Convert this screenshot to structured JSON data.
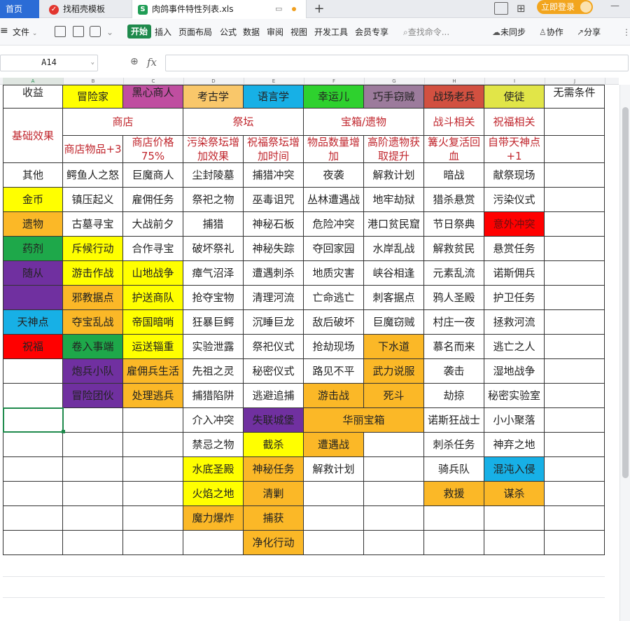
{
  "tabs": [
    {
      "label": "首页",
      "active": false
    },
    {
      "label": "找稻壳模板",
      "active": false
    },
    {
      "label": "肉鸽事件特性列表.xls",
      "active": true
    }
  ],
  "login_label": "立即登录",
  "menu": {
    "file": "文件",
    "items": [
      "开始",
      "插入",
      "页面布局",
      "公式",
      "数据",
      "审阅",
      "视图",
      "开发工具",
      "会员专享"
    ],
    "search_placeholder": "查找命令...",
    "sync": "未同步",
    "collab": "协作",
    "share": "分享"
  },
  "formula_bar": {
    "cell_ref": "A14",
    "fx": "fx",
    "value": ""
  },
  "columns": [
    "A",
    "B",
    "C",
    "D",
    "E",
    "F",
    "G",
    "H",
    "I",
    "J"
  ],
  "colors": {
    "yellow": "#ffff00",
    "pink": "#bf4ea0",
    "tan": "#f9c76a",
    "cyan": "#17b0e6",
    "green": "#2ed12e",
    "mauve": "#9c7b9c",
    "brickred": "#d25040",
    "olive": "#e1e548",
    "orange": "#fbb827",
    "darkgreen": "#1ea84a",
    "purple": "#7030a0",
    "red": "#ff0000",
    "accent": "#1f8a4c"
  },
  "cells": [
    {
      "id": "A1",
      "t": "收益"
    },
    {
      "id": "B1",
      "t": "冒险家"
    },
    {
      "id": "C1",
      "t": "黑心商人"
    },
    {
      "id": "D1",
      "t": "考古学"
    },
    {
      "id": "E1",
      "t": "语言学"
    },
    {
      "id": "F1",
      "t": "幸运儿"
    },
    {
      "id": "G1",
      "t": "巧手窃贼"
    },
    {
      "id": "H1",
      "t": "战场老兵"
    },
    {
      "id": "I1",
      "t": "使徒"
    },
    {
      "id": "J1",
      "t": "无需条件"
    },
    {
      "id": "A2",
      "t": "基础效果"
    },
    {
      "id": "B2",
      "t": "商店"
    },
    {
      "id": "D2",
      "t": "祭坛"
    },
    {
      "id": "F2",
      "t": "宝箱/遗物"
    },
    {
      "id": "H2",
      "t": "战斗相关"
    },
    {
      "id": "I2",
      "t": "祝福相关"
    },
    {
      "id": "B3",
      "t": "商店物品+3"
    },
    {
      "id": "C3",
      "t": "商店价格75%"
    },
    {
      "id": "D3",
      "t": "污染祭坛增加效果"
    },
    {
      "id": "E3",
      "t": "祝福祭坛增加时间"
    },
    {
      "id": "F3",
      "t": "物品数量增加"
    },
    {
      "id": "G3",
      "t": "高阶遗物获取提升"
    },
    {
      "id": "H3",
      "t": "篝火复活回血"
    },
    {
      "id": "I3",
      "t": "自带天神点+1"
    },
    {
      "id": "A4",
      "t": "其他"
    },
    {
      "id": "B4",
      "t": "鳄鱼人之怒"
    },
    {
      "id": "C4",
      "t": "巨魔商人"
    },
    {
      "id": "D4",
      "t": "尘封陵墓"
    },
    {
      "id": "E4",
      "t": "捕猎冲突"
    },
    {
      "id": "F4",
      "t": "夜袭"
    },
    {
      "id": "G4",
      "t": "解救计划"
    },
    {
      "id": "H4",
      "t": "暗战"
    },
    {
      "id": "I4",
      "t": "献祭现场"
    },
    {
      "id": "A5",
      "t": "金币"
    },
    {
      "id": "B5",
      "t": "镇压起义"
    },
    {
      "id": "C5",
      "t": "雇佣任务"
    },
    {
      "id": "D5",
      "t": "祭祀之物"
    },
    {
      "id": "E5",
      "t": "巫毒诅咒"
    },
    {
      "id": "F5",
      "t": "丛林遭遇战"
    },
    {
      "id": "G5",
      "t": "地牢劫狱"
    },
    {
      "id": "H5",
      "t": "猎杀悬赏"
    },
    {
      "id": "I5",
      "t": "污染仪式"
    },
    {
      "id": "A6",
      "t": "遗物"
    },
    {
      "id": "B6",
      "t": "古墓寻宝"
    },
    {
      "id": "C6",
      "t": "大战前夕"
    },
    {
      "id": "D6",
      "t": "捕猎"
    },
    {
      "id": "E6",
      "t": "神秘石板"
    },
    {
      "id": "F6",
      "t": "危险冲突"
    },
    {
      "id": "G6",
      "t": "港口贫民窟"
    },
    {
      "id": "H6",
      "t": "节日祭典"
    },
    {
      "id": "I6",
      "t": "意外冲突"
    },
    {
      "id": "A7",
      "t": "药剂"
    },
    {
      "id": "B7",
      "t": "斥候行动"
    },
    {
      "id": "C7",
      "t": "合作寻宝"
    },
    {
      "id": "D7",
      "t": "破坏祭礼"
    },
    {
      "id": "E7",
      "t": "神秘失踪"
    },
    {
      "id": "F7",
      "t": "夺回家园"
    },
    {
      "id": "G7",
      "t": "水岸乱战"
    },
    {
      "id": "H7",
      "t": "解救贫民"
    },
    {
      "id": "I7",
      "t": "悬赏任务"
    },
    {
      "id": "A8",
      "t": "随从"
    },
    {
      "id": "B8",
      "t": "游击作战"
    },
    {
      "id": "C8",
      "t": "山地战争"
    },
    {
      "id": "D8",
      "t": "瘴气沼泽"
    },
    {
      "id": "E8",
      "t": "遭遇刺杀"
    },
    {
      "id": "F8",
      "t": "地质灾害"
    },
    {
      "id": "G8",
      "t": "峡谷相逢"
    },
    {
      "id": "H8",
      "t": "元素乱流"
    },
    {
      "id": "I8",
      "t": "诺斯佣兵"
    },
    {
      "id": "B9",
      "t": "邪教据点"
    },
    {
      "id": "C9",
      "t": "护送商队"
    },
    {
      "id": "D9",
      "t": "抢夺宝物"
    },
    {
      "id": "E9",
      "t": "清理河流"
    },
    {
      "id": "F9",
      "t": "亡命逃亡"
    },
    {
      "id": "G9",
      "t": "刺客据点"
    },
    {
      "id": "H9",
      "t": "鸦人圣殿"
    },
    {
      "id": "I9",
      "t": "护卫任务"
    },
    {
      "id": "A10",
      "t": "天神点"
    },
    {
      "id": "B10",
      "t": "夺宝乱战"
    },
    {
      "id": "C10",
      "t": "帝国暗哨"
    },
    {
      "id": "D10",
      "t": "狂暴巨鳄"
    },
    {
      "id": "E10",
      "t": "沉睡巨龙"
    },
    {
      "id": "F10",
      "t": "敌后破坏"
    },
    {
      "id": "G10",
      "t": "巨魔窃贼"
    },
    {
      "id": "H10",
      "t": "村庄一夜"
    },
    {
      "id": "I10",
      "t": "拯救河流"
    },
    {
      "id": "A11",
      "t": "祝福"
    },
    {
      "id": "B11",
      "t": "卷入事端"
    },
    {
      "id": "C11",
      "t": "运送辎重"
    },
    {
      "id": "D11",
      "t": "实验泄露"
    },
    {
      "id": "E11",
      "t": "祭祀仪式"
    },
    {
      "id": "F11",
      "t": "抢劫现场"
    },
    {
      "id": "G11",
      "t": "下水道"
    },
    {
      "id": "H11",
      "t": "慕名而来"
    },
    {
      "id": "I11",
      "t": "逃亡之人"
    },
    {
      "id": "B12",
      "t": "炮兵小队"
    },
    {
      "id": "C12",
      "t": "雇佣兵生活"
    },
    {
      "id": "D12",
      "t": "先祖之灵"
    },
    {
      "id": "E12",
      "t": "秘密仪式"
    },
    {
      "id": "F12",
      "t": "路见不平"
    },
    {
      "id": "G12",
      "t": "武力说服"
    },
    {
      "id": "H12",
      "t": "袭击"
    },
    {
      "id": "I12",
      "t": "湿地战争"
    },
    {
      "id": "B13",
      "t": "冒险团伙"
    },
    {
      "id": "C13",
      "t": "处理逃兵"
    },
    {
      "id": "D13",
      "t": "捕猎陷阱"
    },
    {
      "id": "E13",
      "t": "逃避追捕"
    },
    {
      "id": "F13",
      "t": "游击战"
    },
    {
      "id": "G13",
      "t": "死斗"
    },
    {
      "id": "H13",
      "t": "劫掠"
    },
    {
      "id": "I13",
      "t": "秘密实验室"
    },
    {
      "id": "D14",
      "t": "介入冲突"
    },
    {
      "id": "E14",
      "t": "失联城堡"
    },
    {
      "id": "F14",
      "t": "华丽宝箱"
    },
    {
      "id": "H14",
      "t": "诺斯狂战士"
    },
    {
      "id": "I14",
      "t": "小小聚落"
    },
    {
      "id": "D15",
      "t": "禁忌之物"
    },
    {
      "id": "E15",
      "t": "截杀"
    },
    {
      "id": "F15",
      "t": "遭遇战"
    },
    {
      "id": "H15",
      "t": "刺杀任务"
    },
    {
      "id": "I15",
      "t": "神弃之地"
    },
    {
      "id": "D16",
      "t": "水底圣殿"
    },
    {
      "id": "E16",
      "t": "神秘任务"
    },
    {
      "id": "F16",
      "t": "解救计划"
    },
    {
      "id": "H16",
      "t": "骑兵队"
    },
    {
      "id": "I16",
      "t": "混沌入侵"
    },
    {
      "id": "D17",
      "t": "火焰之地"
    },
    {
      "id": "E17",
      "t": "清剿"
    },
    {
      "id": "H17",
      "t": "救援"
    },
    {
      "id": "I17",
      "t": "谋杀"
    },
    {
      "id": "D18",
      "t": "魔力爆炸"
    },
    {
      "id": "E18",
      "t": "捕获"
    },
    {
      "id": "E19",
      "t": "净化行动"
    }
  ]
}
